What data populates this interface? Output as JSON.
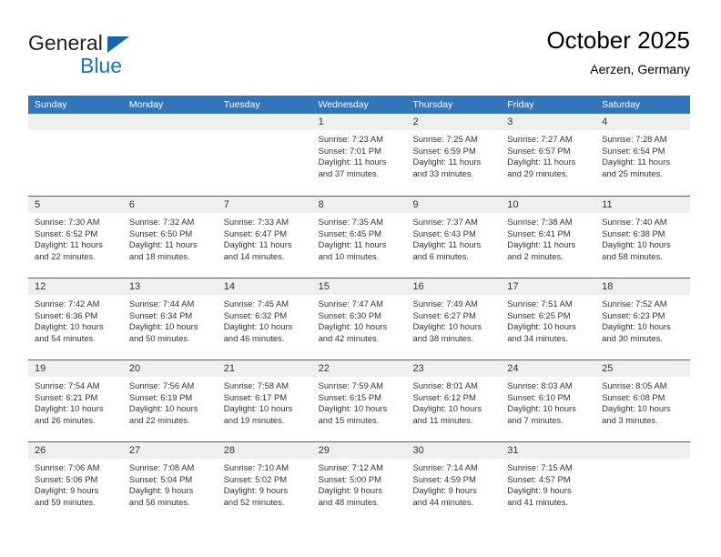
{
  "brand": {
    "name_part1": "General",
    "name_part2": "Blue",
    "accent_color": "#1878be",
    "triangle_color": "#1267ad"
  },
  "header": {
    "title": "October 2025",
    "subtitle": "Aerzen, Germany"
  },
  "calendar": {
    "header_bg": "#3275b9",
    "row_border": "#2c6aa8",
    "daynum_bg": "#efefef",
    "weekdays": [
      "Sunday",
      "Monday",
      "Tuesday",
      "Wednesday",
      "Thursday",
      "Friday",
      "Saturday"
    ],
    "weeks": [
      [
        {
          "day": "",
          "empty": true
        },
        {
          "day": "",
          "empty": true
        },
        {
          "day": "",
          "empty": true
        },
        {
          "day": "1",
          "sunrise": "Sunrise: 7:23 AM",
          "sunset": "Sunset: 7:01 PM",
          "daylight1": "Daylight: 11 hours",
          "daylight2": "and 37 minutes."
        },
        {
          "day": "2",
          "sunrise": "Sunrise: 7:25 AM",
          "sunset": "Sunset: 6:59 PM",
          "daylight1": "Daylight: 11 hours",
          "daylight2": "and 33 minutes."
        },
        {
          "day": "3",
          "sunrise": "Sunrise: 7:27 AM",
          "sunset": "Sunset: 6:57 PM",
          "daylight1": "Daylight: 11 hours",
          "daylight2": "and 29 minutes."
        },
        {
          "day": "4",
          "sunrise": "Sunrise: 7:28 AM",
          "sunset": "Sunset: 6:54 PM",
          "daylight1": "Daylight: 11 hours",
          "daylight2": "and 25 minutes."
        }
      ],
      [
        {
          "day": "5",
          "sunrise": "Sunrise: 7:30 AM",
          "sunset": "Sunset: 6:52 PM",
          "daylight1": "Daylight: 11 hours",
          "daylight2": "and 22 minutes."
        },
        {
          "day": "6",
          "sunrise": "Sunrise: 7:32 AM",
          "sunset": "Sunset: 6:50 PM",
          "daylight1": "Daylight: 11 hours",
          "daylight2": "and 18 minutes."
        },
        {
          "day": "7",
          "sunrise": "Sunrise: 7:33 AM",
          "sunset": "Sunset: 6:47 PM",
          "daylight1": "Daylight: 11 hours",
          "daylight2": "and 14 minutes."
        },
        {
          "day": "8",
          "sunrise": "Sunrise: 7:35 AM",
          "sunset": "Sunset: 6:45 PM",
          "daylight1": "Daylight: 11 hours",
          "daylight2": "and 10 minutes."
        },
        {
          "day": "9",
          "sunrise": "Sunrise: 7:37 AM",
          "sunset": "Sunset: 6:43 PM",
          "daylight1": "Daylight: 11 hours",
          "daylight2": "and 6 minutes."
        },
        {
          "day": "10",
          "sunrise": "Sunrise: 7:38 AM",
          "sunset": "Sunset: 6:41 PM",
          "daylight1": "Daylight: 11 hours",
          "daylight2": "and 2 minutes."
        },
        {
          "day": "11",
          "sunrise": "Sunrise: 7:40 AM",
          "sunset": "Sunset: 6:38 PM",
          "daylight1": "Daylight: 10 hours",
          "daylight2": "and 58 minutes."
        }
      ],
      [
        {
          "day": "12",
          "sunrise": "Sunrise: 7:42 AM",
          "sunset": "Sunset: 6:36 PM",
          "daylight1": "Daylight: 10 hours",
          "daylight2": "and 54 minutes."
        },
        {
          "day": "13",
          "sunrise": "Sunrise: 7:44 AM",
          "sunset": "Sunset: 6:34 PM",
          "daylight1": "Daylight: 10 hours",
          "daylight2": "and 50 minutes."
        },
        {
          "day": "14",
          "sunrise": "Sunrise: 7:45 AM",
          "sunset": "Sunset: 6:32 PM",
          "daylight1": "Daylight: 10 hours",
          "daylight2": "and 46 minutes."
        },
        {
          "day": "15",
          "sunrise": "Sunrise: 7:47 AM",
          "sunset": "Sunset: 6:30 PM",
          "daylight1": "Daylight: 10 hours",
          "daylight2": "and 42 minutes."
        },
        {
          "day": "16",
          "sunrise": "Sunrise: 7:49 AM",
          "sunset": "Sunset: 6:27 PM",
          "daylight1": "Daylight: 10 hours",
          "daylight2": "and 38 minutes."
        },
        {
          "day": "17",
          "sunrise": "Sunrise: 7:51 AM",
          "sunset": "Sunset: 6:25 PM",
          "daylight1": "Daylight: 10 hours",
          "daylight2": "and 34 minutes."
        },
        {
          "day": "18",
          "sunrise": "Sunrise: 7:52 AM",
          "sunset": "Sunset: 6:23 PM",
          "daylight1": "Daylight: 10 hours",
          "daylight2": "and 30 minutes."
        }
      ],
      [
        {
          "day": "19",
          "sunrise": "Sunrise: 7:54 AM",
          "sunset": "Sunset: 6:21 PM",
          "daylight1": "Daylight: 10 hours",
          "daylight2": "and 26 minutes."
        },
        {
          "day": "20",
          "sunrise": "Sunrise: 7:56 AM",
          "sunset": "Sunset: 6:19 PM",
          "daylight1": "Daylight: 10 hours",
          "daylight2": "and 22 minutes."
        },
        {
          "day": "21",
          "sunrise": "Sunrise: 7:58 AM",
          "sunset": "Sunset: 6:17 PM",
          "daylight1": "Daylight: 10 hours",
          "daylight2": "and 19 minutes."
        },
        {
          "day": "22",
          "sunrise": "Sunrise: 7:59 AM",
          "sunset": "Sunset: 6:15 PM",
          "daylight1": "Daylight: 10 hours",
          "daylight2": "and 15 minutes."
        },
        {
          "day": "23",
          "sunrise": "Sunrise: 8:01 AM",
          "sunset": "Sunset: 6:12 PM",
          "daylight1": "Daylight: 10 hours",
          "daylight2": "and 11 minutes."
        },
        {
          "day": "24",
          "sunrise": "Sunrise: 8:03 AM",
          "sunset": "Sunset: 6:10 PM",
          "daylight1": "Daylight: 10 hours",
          "daylight2": "and 7 minutes."
        },
        {
          "day": "25",
          "sunrise": "Sunrise: 8:05 AM",
          "sunset": "Sunset: 6:08 PM",
          "daylight1": "Daylight: 10 hours",
          "daylight2": "and 3 minutes."
        }
      ],
      [
        {
          "day": "26",
          "sunrise": "Sunrise: 7:06 AM",
          "sunset": "Sunset: 5:06 PM",
          "daylight1": "Daylight: 9 hours",
          "daylight2": "and 59 minutes."
        },
        {
          "day": "27",
          "sunrise": "Sunrise: 7:08 AM",
          "sunset": "Sunset: 5:04 PM",
          "daylight1": "Daylight: 9 hours",
          "daylight2": "and 56 minutes."
        },
        {
          "day": "28",
          "sunrise": "Sunrise: 7:10 AM",
          "sunset": "Sunset: 5:02 PM",
          "daylight1": "Daylight: 9 hours",
          "daylight2": "and 52 minutes."
        },
        {
          "day": "29",
          "sunrise": "Sunrise: 7:12 AM",
          "sunset": "Sunset: 5:00 PM",
          "daylight1": "Daylight: 9 hours",
          "daylight2": "and 48 minutes."
        },
        {
          "day": "30",
          "sunrise": "Sunrise: 7:14 AM",
          "sunset": "Sunset: 4:59 PM",
          "daylight1": "Daylight: 9 hours",
          "daylight2": "and 44 minutes."
        },
        {
          "day": "31",
          "sunrise": "Sunrise: 7:15 AM",
          "sunset": "Sunset: 4:57 PM",
          "daylight1": "Daylight: 9 hours",
          "daylight2": "and 41 minutes."
        },
        {
          "day": "",
          "empty": true
        }
      ]
    ]
  }
}
